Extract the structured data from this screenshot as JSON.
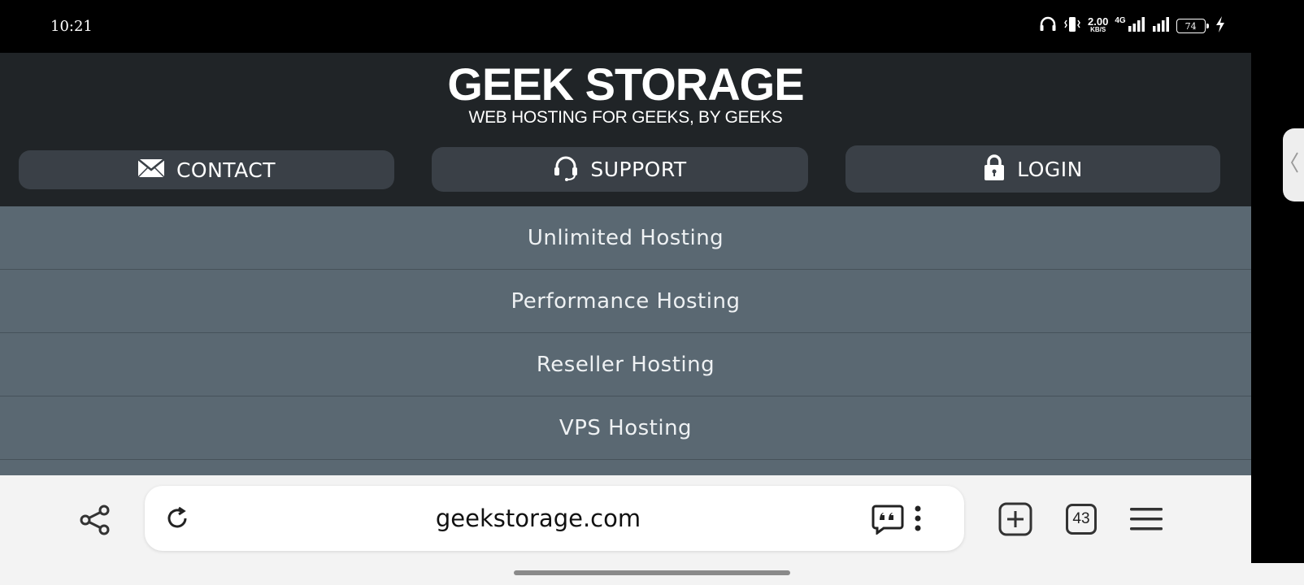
{
  "status_bar": {
    "time": "10:21",
    "net_speed": "2.00",
    "net_speed_unit": "KB/S",
    "network_type": "4G",
    "battery_level": "74"
  },
  "site": {
    "logo_title": "GEEK STORAGE",
    "logo_tagline": "WEB HOSTING FOR GEEKS, BY GEEKS",
    "nav_buttons": [
      {
        "label": "CONTACT",
        "icon": "envelope-icon"
      },
      {
        "label": "SUPPORT",
        "icon": "headset-icon"
      },
      {
        "label": "LOGIN",
        "icon": "lock-icon"
      }
    ],
    "menu_items": [
      {
        "label": "Unlimited Hosting"
      },
      {
        "label": "Performance Hosting"
      },
      {
        "label": "Reseller Hosting"
      },
      {
        "label": "VPS Hosting"
      }
    ]
  },
  "browser": {
    "url": "geekstorage.com",
    "tab_count": "43"
  },
  "colors": {
    "header_bg": "#202427",
    "nav_button_bg": "#3a4047",
    "menu_bg": "#5a6872",
    "toolbar_bg": "#f3f3f3"
  }
}
